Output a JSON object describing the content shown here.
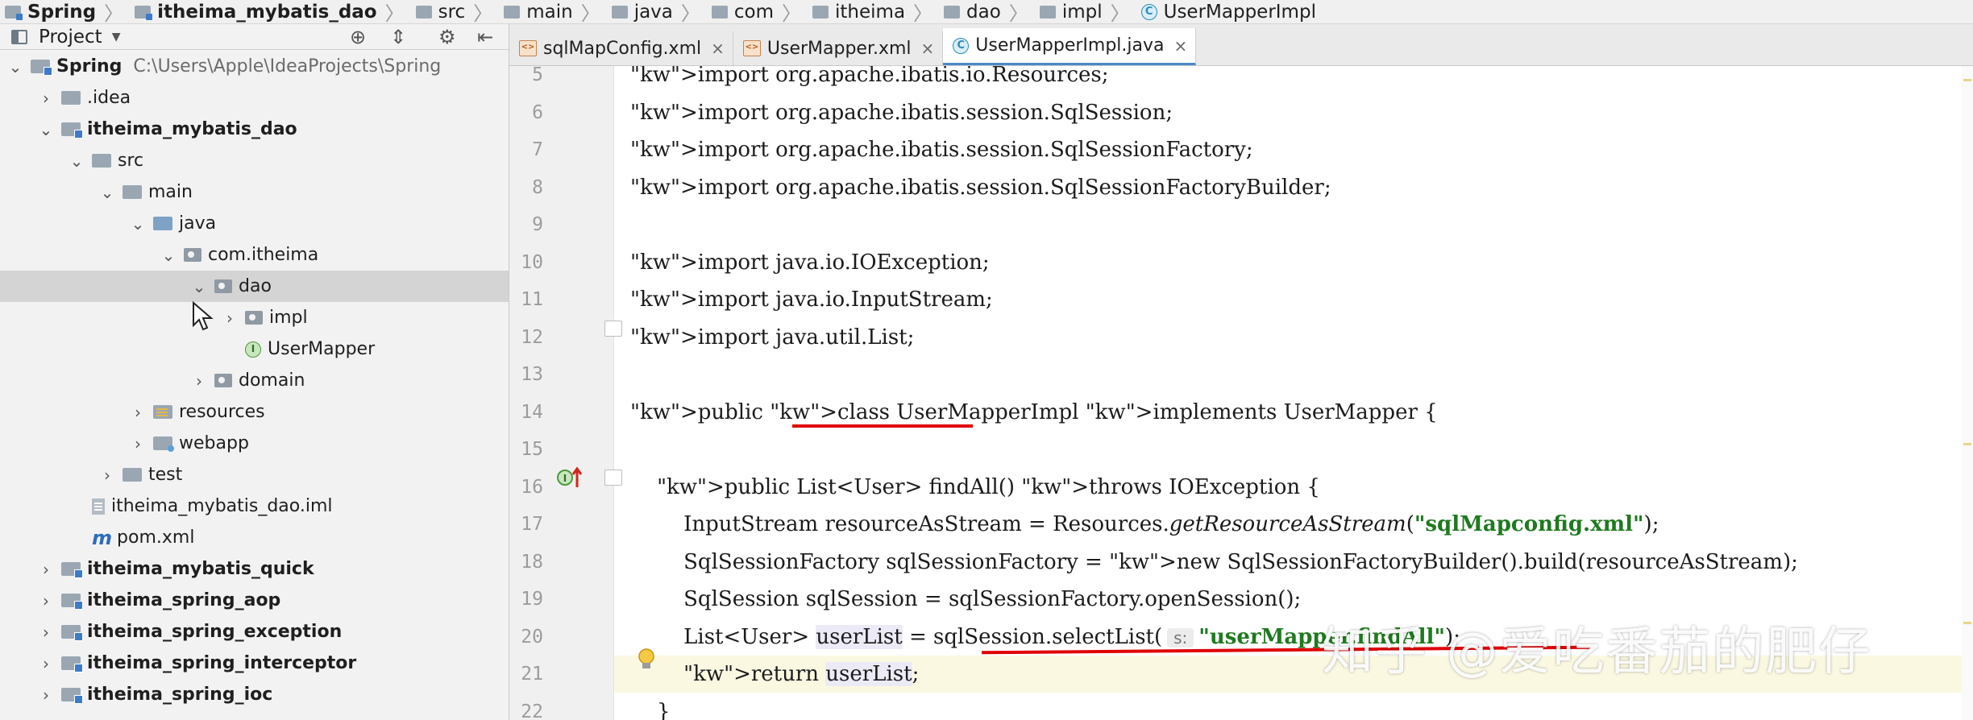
{
  "breadcrumbs": [
    {
      "label": "Spring",
      "icon": "folder-module-icon",
      "bold": true
    },
    {
      "label": "itheima_mybatis_dao",
      "icon": "folder-module-icon",
      "bold": true
    },
    {
      "label": "src",
      "icon": "folder-icon"
    },
    {
      "label": "main",
      "icon": "folder-icon"
    },
    {
      "label": "java",
      "icon": "folder-icon"
    },
    {
      "label": "com",
      "icon": "folder-icon"
    },
    {
      "label": "itheima",
      "icon": "folder-icon"
    },
    {
      "label": "dao",
      "icon": "folder-icon"
    },
    {
      "label": "impl",
      "icon": "folder-icon"
    },
    {
      "label": "UserMapperImpl",
      "icon": "class-icon"
    }
  ],
  "project_panel": {
    "title": "Project",
    "tree": [
      {
        "label": "Spring",
        "path": "C:\\Users\\Apple\\IdeaProjects\\Spring",
        "icon": "module-icon",
        "state": "expanded",
        "bold": true
      },
      {
        "label": ".idea",
        "icon": "folder-icon",
        "state": "collapsed"
      },
      {
        "label": "itheima_mybatis_dao",
        "icon": "module-icon",
        "state": "expanded",
        "bold": true
      },
      {
        "label": "src",
        "icon": "folder-icon",
        "state": "expanded"
      },
      {
        "label": "main",
        "icon": "folder-icon",
        "state": "expanded"
      },
      {
        "label": "java",
        "icon": "source-folder-icon",
        "state": "expanded"
      },
      {
        "label": "com.itheima",
        "icon": "package-icon",
        "state": "expanded"
      },
      {
        "label": "dao",
        "icon": "package-icon",
        "state": "expanded",
        "selected": true
      },
      {
        "label": "impl",
        "icon": "package-icon",
        "state": "collapsed"
      },
      {
        "label": "UserMapper",
        "icon": "interface-icon",
        "state": "leaf"
      },
      {
        "label": "domain",
        "icon": "package-icon",
        "state": "collapsed"
      },
      {
        "label": "resources",
        "icon": "resources-folder-icon",
        "state": "collapsed"
      },
      {
        "label": "webapp",
        "icon": "web-folder-icon",
        "state": "collapsed"
      },
      {
        "label": "test",
        "icon": "folder-icon",
        "state": "collapsed"
      },
      {
        "label": "itheima_mybatis_dao.iml",
        "icon": "iml-file-icon",
        "state": "leaf"
      },
      {
        "label": "pom.xml",
        "icon": "maven-icon",
        "state": "leaf"
      },
      {
        "label": "itheima_mybatis_quick",
        "icon": "module-icon",
        "state": "collapsed",
        "bold": true
      },
      {
        "label": "itheima_spring_aop",
        "icon": "module-icon",
        "state": "collapsed",
        "bold": true
      },
      {
        "label": "itheima_spring_exception",
        "icon": "module-icon",
        "state": "collapsed",
        "bold": true
      },
      {
        "label": "itheima_spring_interceptor",
        "icon": "module-icon",
        "state": "collapsed",
        "bold": true
      },
      {
        "label": "itheima_spring_ioc",
        "icon": "module-icon",
        "state": "collapsed",
        "bold": true
      }
    ]
  },
  "tabs": [
    {
      "label": "sqlMapConfig.xml",
      "icon": "xml-file-icon",
      "active": false
    },
    {
      "label": "UserMapper.xml",
      "icon": "xml-file-icon",
      "active": false
    },
    {
      "label": "UserMapperImpl.java",
      "icon": "class-icon",
      "active": true
    }
  ],
  "editor": {
    "lines": [
      {
        "num": "5",
        "text": "import org.apache.ibatis.io.Resources;"
      },
      {
        "num": "6",
        "text": "import org.apache.ibatis.session.SqlSession;"
      },
      {
        "num": "7",
        "text": "import org.apache.ibatis.session.SqlSessionFactory;"
      },
      {
        "num": "8",
        "text": "import org.apache.ibatis.session.SqlSessionFactoryBuilder;"
      },
      {
        "num": "9",
        "text": ""
      },
      {
        "num": "10",
        "text": "import java.io.IOException;"
      },
      {
        "num": "11",
        "text": "import java.io.InputStream;"
      },
      {
        "num": "12",
        "text": "import java.util.List;"
      },
      {
        "num": "13",
        "text": ""
      },
      {
        "num": "14",
        "text": "public class UserMapperImpl implements UserMapper {"
      },
      {
        "num": "15",
        "text": ""
      },
      {
        "num": "16",
        "text": "    public List<User> findAll() throws IOException {"
      },
      {
        "num": "17",
        "text": "        InputStream resourceAsStream = Resources.getResourceAsStream(\"sqlMapconfig.xml\");"
      },
      {
        "num": "18",
        "text": "        SqlSessionFactory sqlSessionFactory = new SqlSessionFactoryBuilder().build(resourceAsStream);"
      },
      {
        "num": "19",
        "text": "        SqlSession sqlSession = sqlSessionFactory.openSession();"
      },
      {
        "num": "20",
        "text": "        List<User> userList = sqlSession.selectList( s: \"userMapper.findAll\");"
      },
      {
        "num": "21",
        "text": "        return userList;"
      },
      {
        "num": "22",
        "text": "    }"
      }
    ],
    "hint_label": "s:",
    "current_line": "21"
  },
  "watermark": "知乎 @爱吃番茄的肥仔",
  "colors": {
    "keyword": "#0d1f8c",
    "string": "#1f7a1f",
    "annotation_underline": "#e00000",
    "tab_active_border": "#4a88c7"
  }
}
